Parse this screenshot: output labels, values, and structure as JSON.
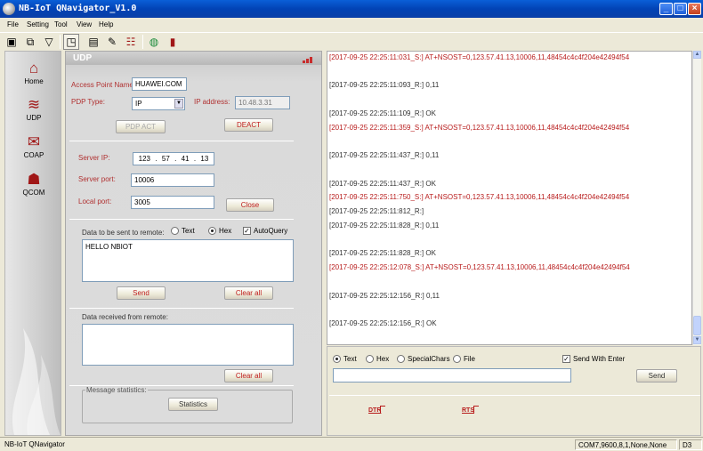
{
  "window": {
    "title": "NB-IoT QNavigator_V1.0"
  },
  "menu": [
    "File",
    "Setting",
    "Tool",
    "View",
    "Help"
  ],
  "toolbar_icons": [
    "save-icon",
    "copy-icon",
    "filter-icon",
    "preview-icon",
    "memory-icon",
    "highlight-icon",
    "notes-icon",
    "globe-icon",
    "book-icon"
  ],
  "nav": [
    {
      "label": "Home",
      "icon": "⌂"
    },
    {
      "label": "UDP",
      "icon": "≋"
    },
    {
      "label": "COAP",
      "icon": "✉"
    },
    {
      "label": "QCOM",
      "icon": "☗"
    }
  ],
  "udp": {
    "title": "UDP",
    "apn_label": "Access Point Name:",
    "apn_value": "HUAWEI.COM",
    "pdp_label": "PDP Type:",
    "pdp_value": "IP",
    "ip_label": "IP address:",
    "ip_value": "10.48.3.31",
    "pdp_act": "PDP ACT",
    "deact": "DEACT",
    "server_ip_label": "Server IP:",
    "server_ip": [
      "123",
      "57",
      "41",
      "13"
    ],
    "server_port_label": "Server port:",
    "server_port": "10006",
    "local_port_label": "Local port:",
    "local_port": "3005",
    "close": "Close",
    "send_label": "Data to be sent to remote:",
    "opt_text": "Text",
    "opt_hex": "Hex",
    "opt_autoquery": "AutoQuery",
    "send_data": "HELLO NBIOT",
    "send_btn": "Send",
    "clear_btn": "Clear all",
    "recv_label": "Data received from remote:",
    "recv_clear": "Clear all",
    "stats_label": "Message statistics:",
    "stats_btn": "Statistics"
  },
  "log": [
    {
      "t": "s",
      "text": "[2017-09-25 22:25:11:031_S:] AT+NSOST=0,123.57.41.13,10006,11,48454c4c4f204e42494f54"
    },
    {
      "t": "r",
      "text": "[2017-09-25 22:25:11:093_R:] 0,11"
    },
    {
      "t": "r",
      "text": "[2017-09-25 22:25:11:109_R:] OK"
    },
    {
      "t": "s",
      "text": "[2017-09-25 22:25:11:359_S:] AT+NSOST=0,123.57.41.13,10006,11,48454c4c4f204e42494f54"
    },
    {
      "t": "r",
      "text": "[2017-09-25 22:25:11:437_R:] 0,11"
    },
    {
      "t": "r",
      "text": "[2017-09-25 22:25:11:437_R:] OK"
    },
    {
      "t": "s",
      "text": "[2017-09-25 22:25:11:750_S:] AT+NSOST=0,123.57.41.13,10006,11,48454c4c4f204e42494f54"
    },
    {
      "t": "r",
      "text": "[2017-09-25 22:25:11:812_R:]"
    },
    {
      "t": "r",
      "text": "[2017-09-25 22:25:11:828_R:] 0,11"
    },
    {
      "t": "r",
      "text": "[2017-09-25 22:25:11:828_R:] OK"
    },
    {
      "t": "s",
      "text": "[2017-09-25 22:25:12:078_S:] AT+NSOST=0,123.57.41.13,10006,11,48454c4c4f204e42494f54"
    },
    {
      "t": "r",
      "text": "[2017-09-25 22:25:12:156_R:] 0,11"
    },
    {
      "t": "r",
      "text": "[2017-09-25 22:25:12:156_R:] OK"
    }
  ],
  "sendbar": {
    "text": "Text",
    "hex": "Hex",
    "special": "SpecialChars",
    "file": "File",
    "send_with_enter": "Send With Enter",
    "send": "Send",
    "dtr": "DTR",
    "rts": "RTS"
  },
  "status": {
    "app": "NB-IoT QNavigator",
    "port": "COM7,9600,8,1,None,None",
    "extra": "D3"
  }
}
